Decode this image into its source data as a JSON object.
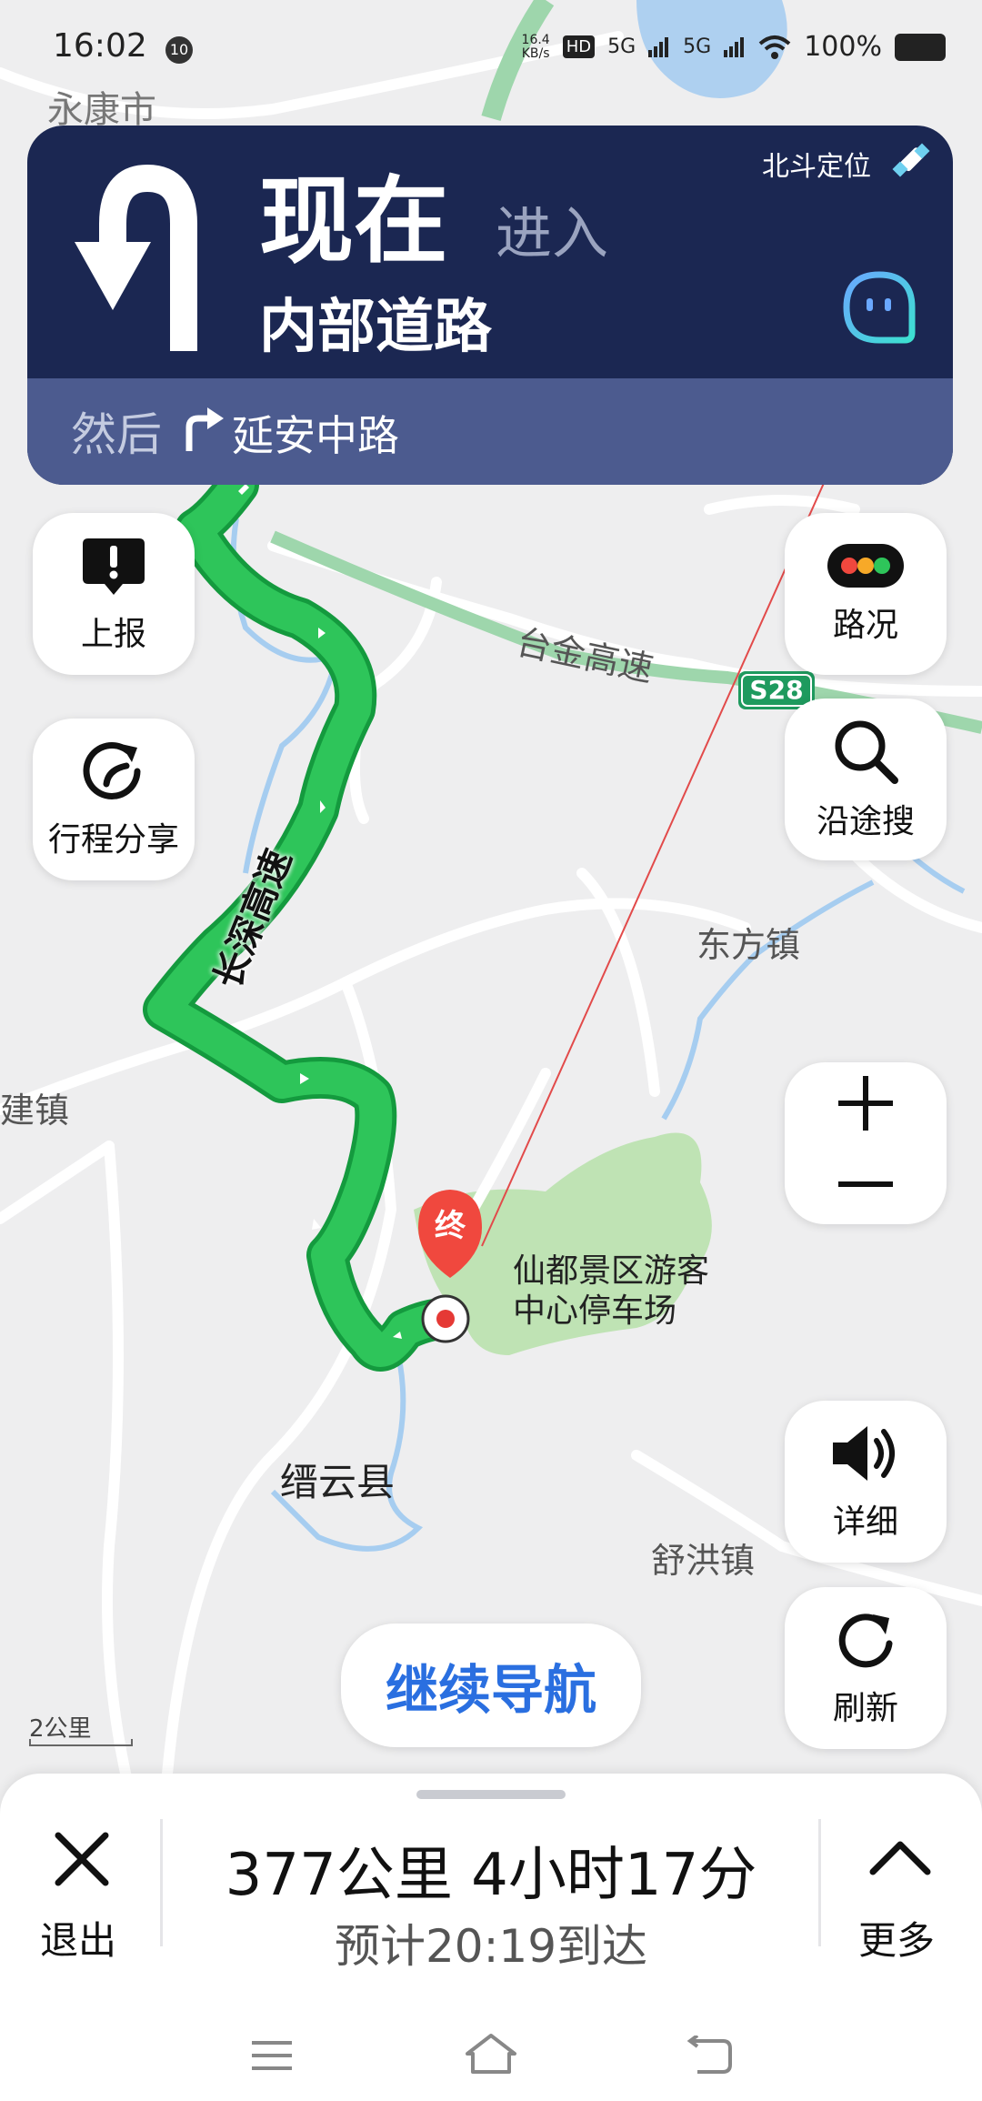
{
  "status_bar": {
    "time": "16:02",
    "notification_badge": "10",
    "net_speed_value": "16.4",
    "net_speed_unit": "KB/s",
    "hd_label": "HD",
    "sim1_label": "5G",
    "sim2_label": "5G",
    "battery": "100%"
  },
  "map": {
    "labels": {
      "yongkang": "永康市",
      "taijin": "台金高速",
      "s28": "S28",
      "dongfang": "东方镇",
      "jianzhen": "建镇",
      "changshen": "长深高速",
      "xiandu_line1": "仙都景区游客",
      "xiandu_line2": "中心停车场",
      "jinyun": "缙云县",
      "shuhong": "舒洪镇",
      "dest_marker": "终"
    },
    "scale": "2公里",
    "route_color": "#1fb04c",
    "continue_nav": "继续导航"
  },
  "banner": {
    "now": "现在",
    "enter": "进入",
    "road": "内部道路",
    "positioning": "北斗定位",
    "then": "然后",
    "next_road": "延安中路",
    "bg_color": "#1b2752"
  },
  "side_buttons": {
    "report": "上报",
    "share": "行程分享",
    "traffic": "路况",
    "search_along": "沿途搜",
    "detail": "详细",
    "refresh": "刷新"
  },
  "bottom": {
    "exit": "退出",
    "summary": "377公里 4小时17分",
    "eta": "预计20:19到达",
    "more": "更多"
  }
}
